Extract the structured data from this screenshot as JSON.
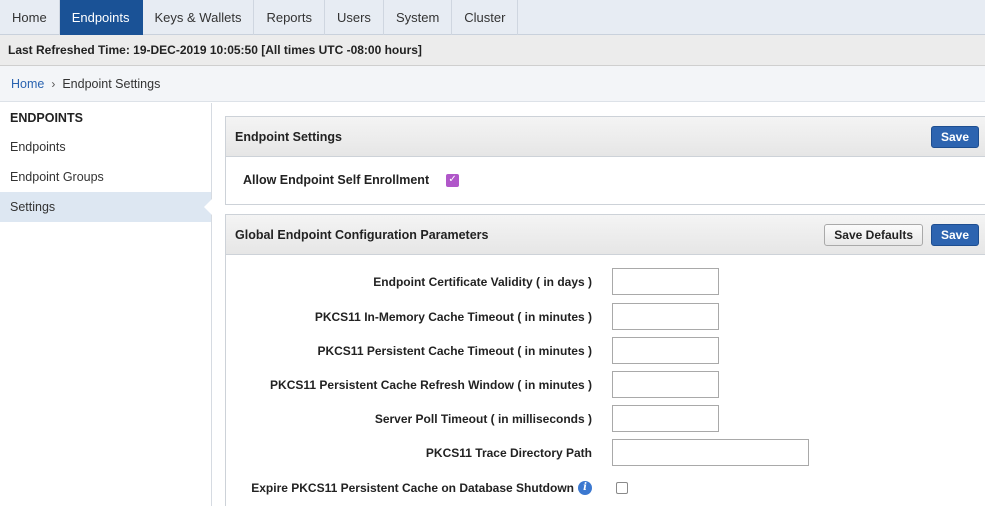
{
  "nav": {
    "tabs": [
      {
        "label": "Home"
      },
      {
        "label": "Endpoints"
      },
      {
        "label": "Keys & Wallets"
      },
      {
        "label": "Reports"
      },
      {
        "label": "Users"
      },
      {
        "label": "System"
      },
      {
        "label": "Cluster"
      }
    ],
    "active_tab": "Endpoints"
  },
  "refresh_bar": {
    "text": "Last Refreshed Time: 19-DEC-2019 10:05:50 [All times UTC -08:00 hours]"
  },
  "breadcrumb": {
    "home": "Home",
    "separator": "›",
    "current": "Endpoint Settings"
  },
  "sidebar": {
    "heading": "ENDPOINTS",
    "items": [
      {
        "label": "Endpoints"
      },
      {
        "label": "Endpoint Groups"
      },
      {
        "label": "Settings"
      }
    ],
    "active_item": "Settings"
  },
  "endpoint_settings": {
    "title": "Endpoint Settings",
    "save_label": "Save",
    "self_enrollment_label": "Allow Endpoint Self Enrollment",
    "self_enrollment_checked": true
  },
  "global_params": {
    "title": "Global Endpoint Configuration Parameters",
    "save_defaults_label": "Save Defaults",
    "save_label": "Save",
    "fields": [
      {
        "label": "Endpoint Certificate Validity ( in days )",
        "value": ""
      },
      {
        "label": "PKCS11 In-Memory Cache Timeout ( in minutes )",
        "value": ""
      },
      {
        "label": "PKCS11 Persistent Cache Timeout ( in minutes )",
        "value": ""
      },
      {
        "label": "PKCS11 Persistent Cache Refresh Window ( in minutes )",
        "value": ""
      },
      {
        "label": "Server Poll Timeout ( in milliseconds )",
        "value": ""
      },
      {
        "label": "PKCS11 Trace Directory Path",
        "value": ""
      }
    ],
    "expire_label": "Expire PKCS11 Persistent Cache on Database Shutdown",
    "expire_checked": false
  },
  "colors": {
    "accent": "#1a5296",
    "save_button": "#2d64b0",
    "checkbox_on": "#b057c9",
    "info_icon": "#3b78d0"
  },
  "icons": {
    "info": "info-icon",
    "checked": "checkmark-icon",
    "breadcrumb_sep": "chevron-right-icon"
  }
}
